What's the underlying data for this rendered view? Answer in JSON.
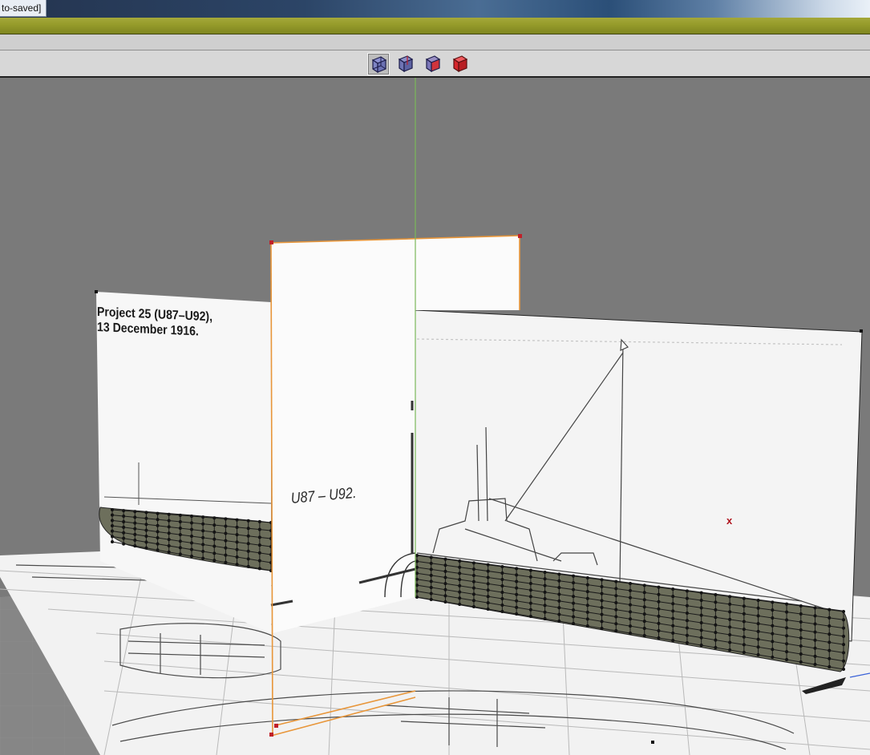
{
  "window": {
    "title_fragment": "to-saved]"
  },
  "toolbar": {
    "view_buttons": [
      {
        "icon": "wireframe-cube-icon",
        "active": true
      },
      {
        "icon": "hidden-line-cube-icon",
        "active": false
      },
      {
        "icon": "shaded-cube-icon",
        "active": false
      },
      {
        "icon": "solid-red-cube-icon",
        "active": false
      }
    ]
  },
  "viewport": {
    "blueprint_labels": {
      "project_line1": "Project 25 (U87–U92),",
      "project_line2": "13 December 1916.",
      "class_label": "U87 – U92."
    },
    "marker": "x"
  },
  "colors": {
    "viewport_bg": "#7a7a7a",
    "selection": "#e8963a",
    "green_axis": "#7ab85a",
    "hull_fill": "#6d6f5c",
    "vertex": "#111111"
  }
}
